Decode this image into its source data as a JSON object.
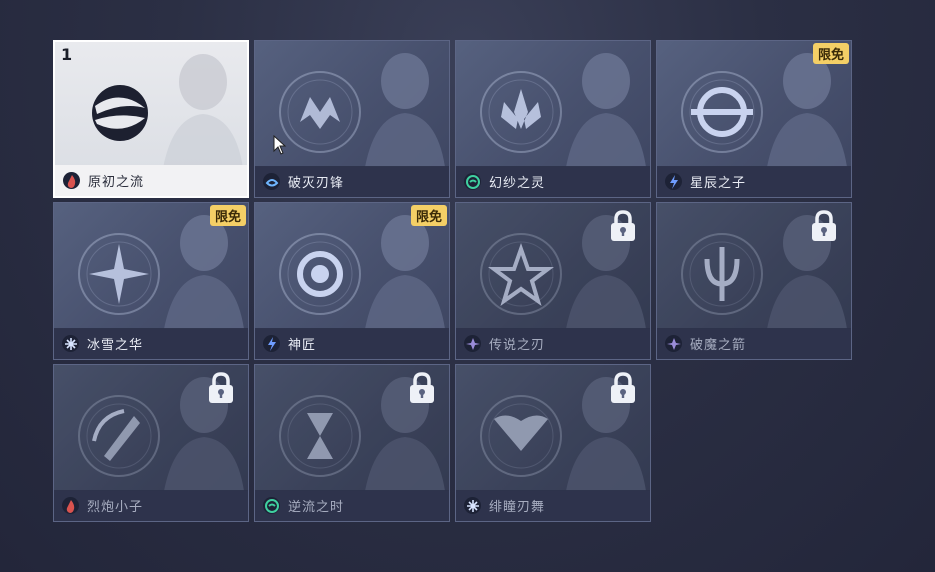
{
  "selected_slot_number": "1",
  "heroes": [
    {
      "name": "原初之流",
      "element": "fire-icon",
      "elementColor": "#d9534f",
      "badge": "",
      "locked": false,
      "selected": true,
      "emblem": "yin-yang-emblem"
    },
    {
      "name": "破灭刃锋",
      "element": "water-icon",
      "elementColor": "#6fb6ff",
      "badge": "",
      "locked": false,
      "selected": false,
      "emblem": "blade-crown-emblem"
    },
    {
      "name": "幻纱之灵",
      "element": "wind-icon",
      "elementColor": "#3fd0a0",
      "badge": "",
      "locked": false,
      "selected": false,
      "emblem": "lotus-emblem"
    },
    {
      "name": "星辰之子",
      "element": "lightning-icon",
      "elementColor": "#6f9dff",
      "badge": "限免",
      "locked": false,
      "selected": false,
      "emblem": "orbit-emblem"
    },
    {
      "name": "冰雪之华",
      "element": "ice-icon",
      "elementColor": "#d8e4ff",
      "badge": "限免",
      "locked": false,
      "selected": false,
      "emblem": "snowflake-emblem"
    },
    {
      "name": "神匠",
      "element": "lightning-icon",
      "elementColor": "#6f9dff",
      "badge": "限免",
      "locked": false,
      "selected": false,
      "emblem": "gear-emblem"
    },
    {
      "name": "传说之刃",
      "element": "shadow-icon",
      "elementColor": "#9a8cd8",
      "badge": "",
      "locked": true,
      "selected": false,
      "emblem": "flower-blade-emblem"
    },
    {
      "name": "破魔之箭",
      "element": "shadow-icon",
      "elementColor": "#9a8cd8",
      "badge": "",
      "locked": true,
      "selected": false,
      "emblem": "trident-emblem"
    },
    {
      "name": "烈炮小子",
      "element": "fire-icon",
      "elementColor": "#d9534f",
      "badge": "",
      "locked": true,
      "selected": false,
      "emblem": "cannon-emblem"
    },
    {
      "name": "逆流之时",
      "element": "wind-icon",
      "elementColor": "#3fd0a0",
      "badge": "",
      "locked": true,
      "selected": false,
      "emblem": "hourglass-emblem"
    },
    {
      "name": "绯瞳刃舞",
      "element": "ice-icon",
      "elementColor": "#d8e4ff",
      "badge": "",
      "locked": true,
      "selected": false,
      "emblem": "wings-emblem"
    }
  ]
}
